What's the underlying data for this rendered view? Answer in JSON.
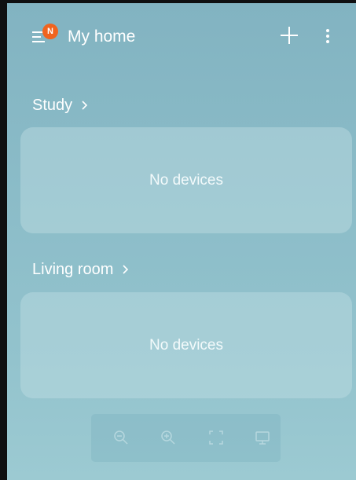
{
  "header": {
    "title": "My home",
    "badge": "N",
    "icons": {
      "menu": "menu-icon",
      "add": "plus-icon",
      "more": "more-vertical-icon"
    }
  },
  "rooms": [
    {
      "name": "Study",
      "empty_text": "No devices"
    },
    {
      "name": "Living room",
      "empty_text": "No devices"
    }
  ],
  "toolbar": {
    "icons": [
      "zoom-out-icon",
      "zoom-in-icon",
      "fit-screen-icon",
      "screen-icon"
    ]
  },
  "colors": {
    "background": "#8bbcc8",
    "card": "#c4e0e5",
    "badge": "#f0641f",
    "text": "#ffffff"
  }
}
